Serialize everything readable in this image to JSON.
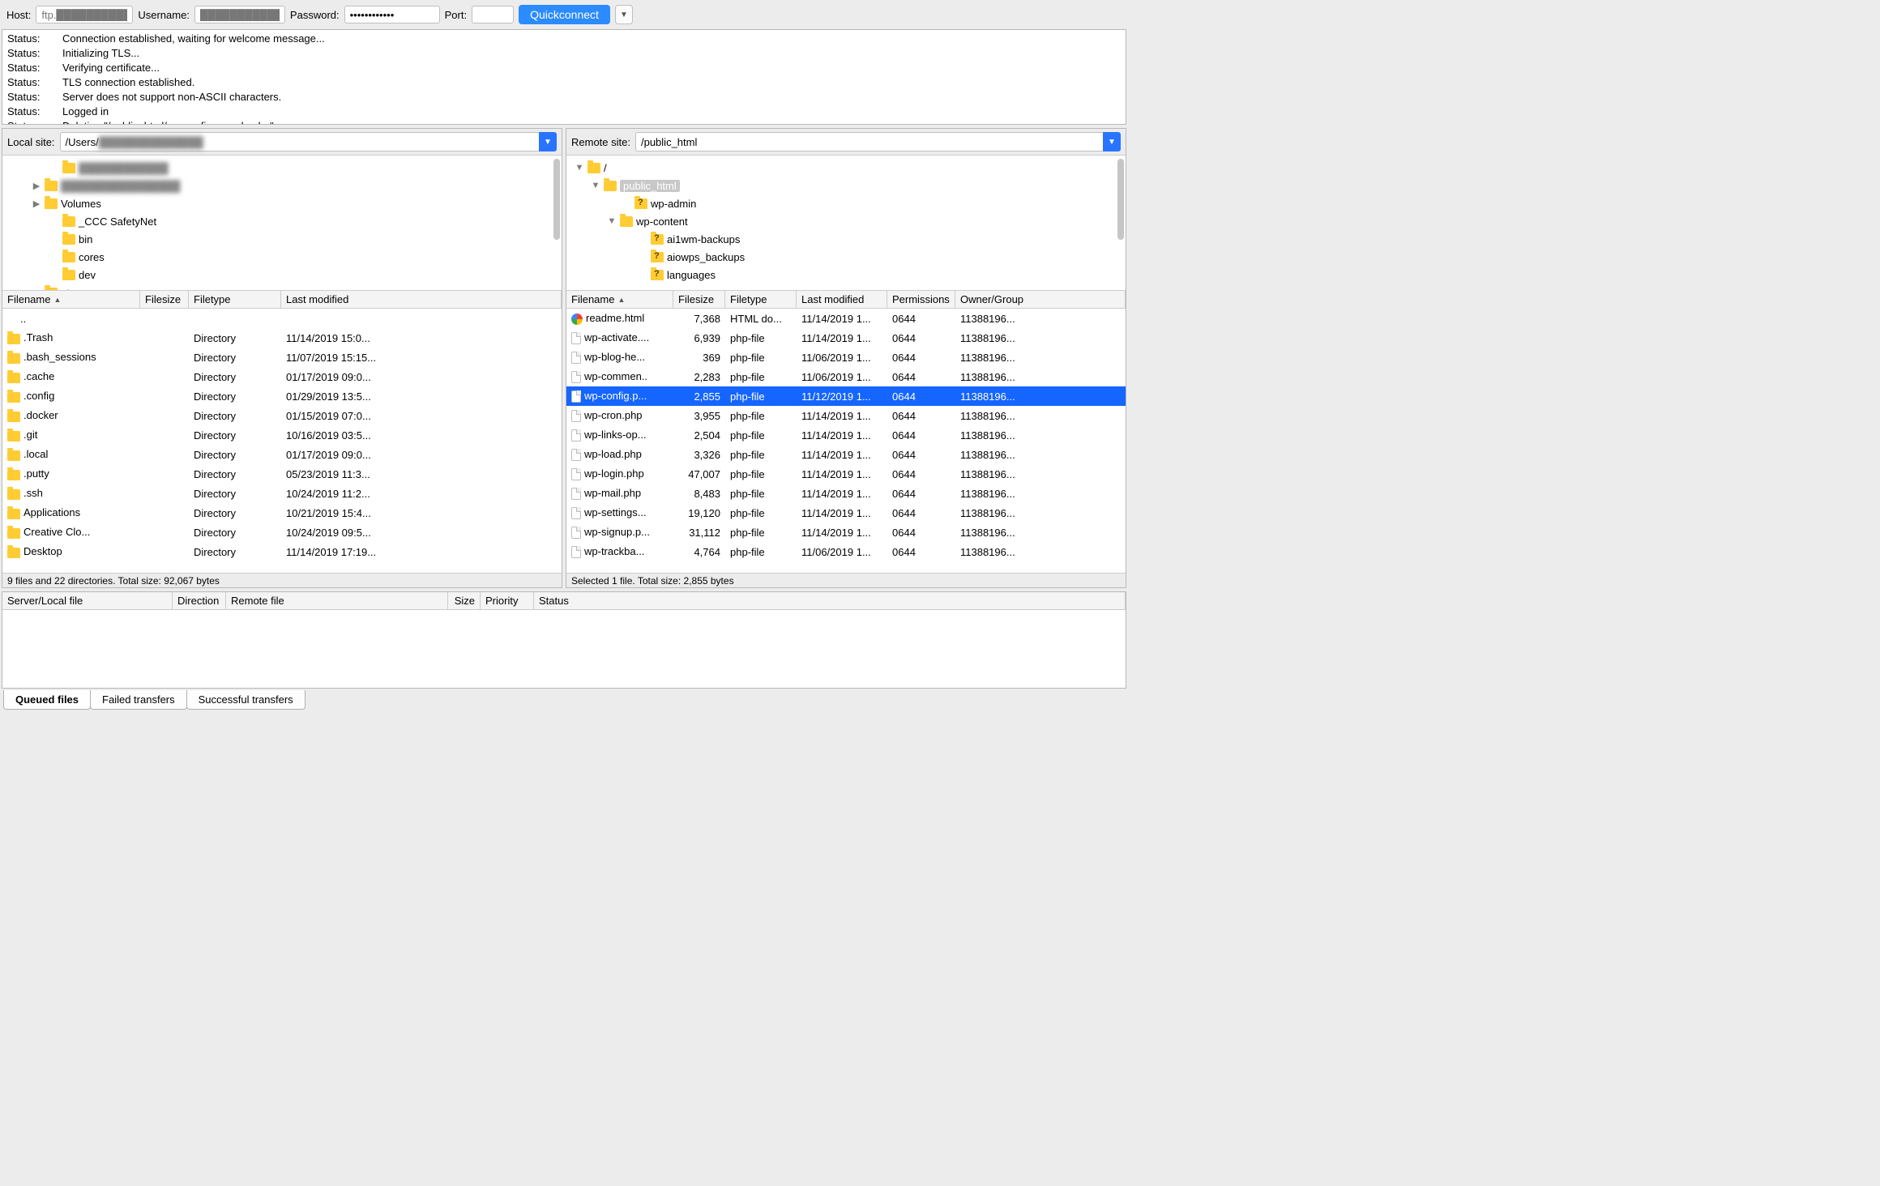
{
  "conn": {
    "host_label": "Host:",
    "username_label": "Username:",
    "password_label": "Password:",
    "port_label": "Port:",
    "quickconnect": "Quickconnect",
    "host_value": "ftp.██████████.net",
    "username_value": "████████████",
    "password_dots": "●●●●●●●●●●●●",
    "port_value": ""
  },
  "log": [
    "Connection established, waiting for welcome message...",
    "Initializing TLS...",
    "Verifying certificate...",
    "TLS connection established.",
    "Server does not support non-ASCII characters.",
    "Logged in",
    "Deleting \"/public_html/wp-config-sample.php\""
  ],
  "log_label": "Status:",
  "local": {
    "site_label": "Local site:",
    "path_prefix": "/Users/",
    "path_hidden": "██████████████",
    "tree": [
      {
        "indent": 58,
        "twist": "",
        "name": "████████████",
        "blur": true
      },
      {
        "indent": 36,
        "twist": "▶",
        "name": "████████████████",
        "blur": true
      },
      {
        "indent": 36,
        "twist": "▶",
        "name": "Volumes"
      },
      {
        "indent": 58,
        "twist": "",
        "name": "_CCC SafetyNet"
      },
      {
        "indent": 58,
        "twist": "",
        "name": "bin"
      },
      {
        "indent": 58,
        "twist": "",
        "name": "cores"
      },
      {
        "indent": 58,
        "twist": "",
        "name": "dev"
      },
      {
        "indent": 36,
        "twist": "▶",
        "name": "etc"
      }
    ],
    "cols": {
      "name": "Filename",
      "size": "Filesize",
      "type": "Filetype",
      "mod": "Last modified"
    },
    "files": [
      {
        "icon": "up",
        "name": "..",
        "size": "",
        "type": "",
        "mod": ""
      },
      {
        "icon": "folder",
        "name": ".Trash",
        "size": "",
        "type": "Directory",
        "mod": "11/14/2019 15:0..."
      },
      {
        "icon": "folder",
        "name": ".bash_sessions",
        "size": "",
        "type": "Directory",
        "mod": "11/07/2019 15:15..."
      },
      {
        "icon": "folder",
        "name": ".cache",
        "size": "",
        "type": "Directory",
        "mod": "01/17/2019 09:0..."
      },
      {
        "icon": "folder",
        "name": ".config",
        "size": "",
        "type": "Directory",
        "mod": "01/29/2019 13:5..."
      },
      {
        "icon": "folder",
        "name": ".docker",
        "size": "",
        "type": "Directory",
        "mod": "01/15/2019 07:0..."
      },
      {
        "icon": "folder",
        "name": ".git",
        "size": "",
        "type": "Directory",
        "mod": "10/16/2019 03:5..."
      },
      {
        "icon": "folder",
        "name": ".local",
        "size": "",
        "type": "Directory",
        "mod": "01/17/2019 09:0..."
      },
      {
        "icon": "folder",
        "name": ".putty",
        "size": "",
        "type": "Directory",
        "mod": "05/23/2019 11:3..."
      },
      {
        "icon": "folder",
        "name": ".ssh",
        "size": "",
        "type": "Directory",
        "mod": "10/24/2019 11:2..."
      },
      {
        "icon": "folder",
        "name": "Applications",
        "size": "",
        "type": "Directory",
        "mod": "10/21/2019 15:4..."
      },
      {
        "icon": "folder",
        "name": "Creative Clo...",
        "size": "",
        "type": "Directory",
        "mod": "10/24/2019 09:5..."
      },
      {
        "icon": "folder",
        "name": "Desktop",
        "size": "",
        "type": "Directory",
        "mod": "11/14/2019 17:19..."
      }
    ],
    "status": "9 files and 22 directories. Total size: 92,067 bytes"
  },
  "remote": {
    "site_label": "Remote site:",
    "path": "/public_html",
    "tree": [
      {
        "indent": 10,
        "twist": "▼",
        "name": "/",
        "q": false
      },
      {
        "indent": 30,
        "twist": "▼",
        "name": "public_html",
        "q": false,
        "sel": true
      },
      {
        "indent": 68,
        "twist": "",
        "name": "wp-admin",
        "q": true
      },
      {
        "indent": 50,
        "twist": "▼",
        "name": "wp-content",
        "q": false
      },
      {
        "indent": 88,
        "twist": "",
        "name": "ai1wm-backups",
        "q": true
      },
      {
        "indent": 88,
        "twist": "",
        "name": "aiowps_backups",
        "q": true
      },
      {
        "indent": 88,
        "twist": "",
        "name": "languages",
        "q": true
      }
    ],
    "cols": {
      "name": "Filename",
      "size": "Filesize",
      "type": "Filetype",
      "mod": "Last modified",
      "perm": "Permissions",
      "own": "Owner/Group"
    },
    "files": [
      {
        "icon": "html",
        "name": "readme.html",
        "size": "7,368",
        "type": "HTML do...",
        "mod": "11/14/2019 1...",
        "perm": "0644",
        "own": "11388196..."
      },
      {
        "icon": "file",
        "name": "wp-activate....",
        "size": "6,939",
        "type": "php-file",
        "mod": "11/14/2019 1...",
        "perm": "0644",
        "own": "11388196..."
      },
      {
        "icon": "file",
        "name": "wp-blog-he...",
        "size": "369",
        "type": "php-file",
        "mod": "11/06/2019 1...",
        "perm": "0644",
        "own": "11388196..."
      },
      {
        "icon": "file",
        "name": "wp-commen..",
        "size": "2,283",
        "type": "php-file",
        "mod": "11/06/2019 1...",
        "perm": "0644",
        "own": "11388196..."
      },
      {
        "icon": "file",
        "name": "wp-config.p...",
        "size": "2,855",
        "type": "php-file",
        "mod": "11/12/2019 1...",
        "perm": "0644",
        "own": "11388196...",
        "sel": true
      },
      {
        "icon": "file",
        "name": "wp-cron.php",
        "size": "3,955",
        "type": "php-file",
        "mod": "11/14/2019 1...",
        "perm": "0644",
        "own": "11388196..."
      },
      {
        "icon": "file",
        "name": "wp-links-op...",
        "size": "2,504",
        "type": "php-file",
        "mod": "11/14/2019 1...",
        "perm": "0644",
        "own": "11388196..."
      },
      {
        "icon": "file",
        "name": "wp-load.php",
        "size": "3,326",
        "type": "php-file",
        "mod": "11/14/2019 1...",
        "perm": "0644",
        "own": "11388196..."
      },
      {
        "icon": "file",
        "name": "wp-login.php",
        "size": "47,007",
        "type": "php-file",
        "mod": "11/14/2019 1...",
        "perm": "0644",
        "own": "11388196..."
      },
      {
        "icon": "file",
        "name": "wp-mail.php",
        "size": "8,483",
        "type": "php-file",
        "mod": "11/14/2019 1...",
        "perm": "0644",
        "own": "11388196..."
      },
      {
        "icon": "file",
        "name": "wp-settings...",
        "size": "19,120",
        "type": "php-file",
        "mod": "11/14/2019 1...",
        "perm": "0644",
        "own": "11388196..."
      },
      {
        "icon": "file",
        "name": "wp-signup.p...",
        "size": "31,112",
        "type": "php-file",
        "mod": "11/14/2019 1...",
        "perm": "0644",
        "own": "11388196..."
      },
      {
        "icon": "file",
        "name": "wp-trackba...",
        "size": "4,764",
        "type": "php-file",
        "mod": "11/06/2019 1...",
        "perm": "0644",
        "own": "11388196..."
      }
    ],
    "status": "Selected 1 file. Total size: 2,855 bytes"
  },
  "queue": {
    "cols": {
      "file": "Server/Local file",
      "dir": "Direction",
      "rem": "Remote file",
      "size": "Size",
      "pri": "Priority",
      "status": "Status"
    }
  },
  "tabs": {
    "queued": "Queued files",
    "failed": "Failed transfers",
    "success": "Successful transfers"
  }
}
